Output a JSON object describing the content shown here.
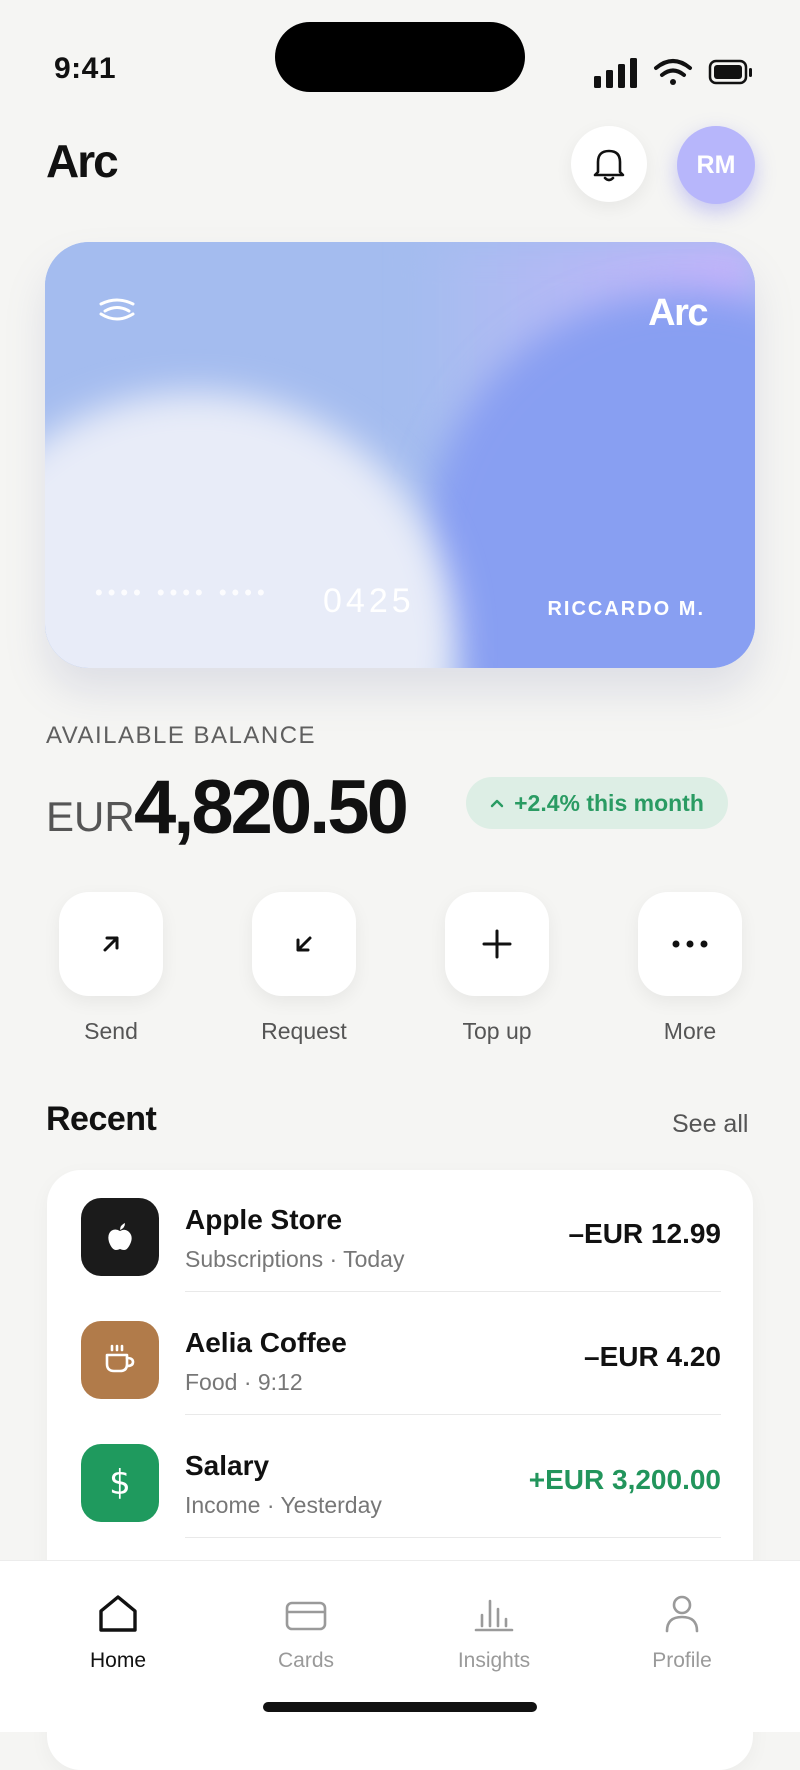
{
  "status_bar": {
    "time": "9:41"
  },
  "header": {
    "title": "Arc",
    "avatar_initials": "RM"
  },
  "card": {
    "brand": "Arc",
    "masked": "•••• •••• ••••",
    "last4": "0425",
    "holder": "RICCARDO M."
  },
  "balance": {
    "label": "AVAILABLE BALANCE",
    "currency": "EUR",
    "amount": "4,820.50",
    "change": "+2.4% this month"
  },
  "actions": [
    {
      "label": "Send",
      "icon": "arrow-up-right-icon"
    },
    {
      "label": "Request",
      "icon": "arrow-down-left-icon"
    },
    {
      "label": "Top up",
      "icon": "plus-icon"
    },
    {
      "label": "More",
      "icon": "more-icon"
    }
  ],
  "recent": {
    "title": "Recent",
    "see_all": "See all",
    "transactions": [
      {
        "name": "Apple Store",
        "sub": "Subscriptions · Today",
        "amount": "–EUR 12.99",
        "icon": "apple-icon",
        "icon_bg": "#1b1b1b",
        "amount_color": "#111111"
      },
      {
        "name": "Aelia Coffee",
        "sub": "Food · 9:12",
        "amount": "–EUR 4.20",
        "icon": "coffee-icon",
        "icon_bg": "#b17b4a",
        "amount_color": "#111111"
      },
      {
        "name": "Salary",
        "sub": "Income · Yesterday",
        "amount": "+EUR 3,200.00",
        "icon": "dollar-icon",
        "icon_bg": "#1f9a5e",
        "amount_color": "#22955c"
      }
    ]
  },
  "tabs": [
    {
      "label": "Home",
      "icon": "home-icon",
      "active": true
    },
    {
      "label": "Cards",
      "icon": "card-icon",
      "active": false
    },
    {
      "label": "Insights",
      "icon": "chart-icon",
      "active": false
    },
    {
      "label": "Profile",
      "icon": "person-icon",
      "active": false
    }
  ],
  "colors": {
    "accent": "#b7b6fb",
    "positive": "#22955c",
    "background": "#f5f5f3"
  }
}
